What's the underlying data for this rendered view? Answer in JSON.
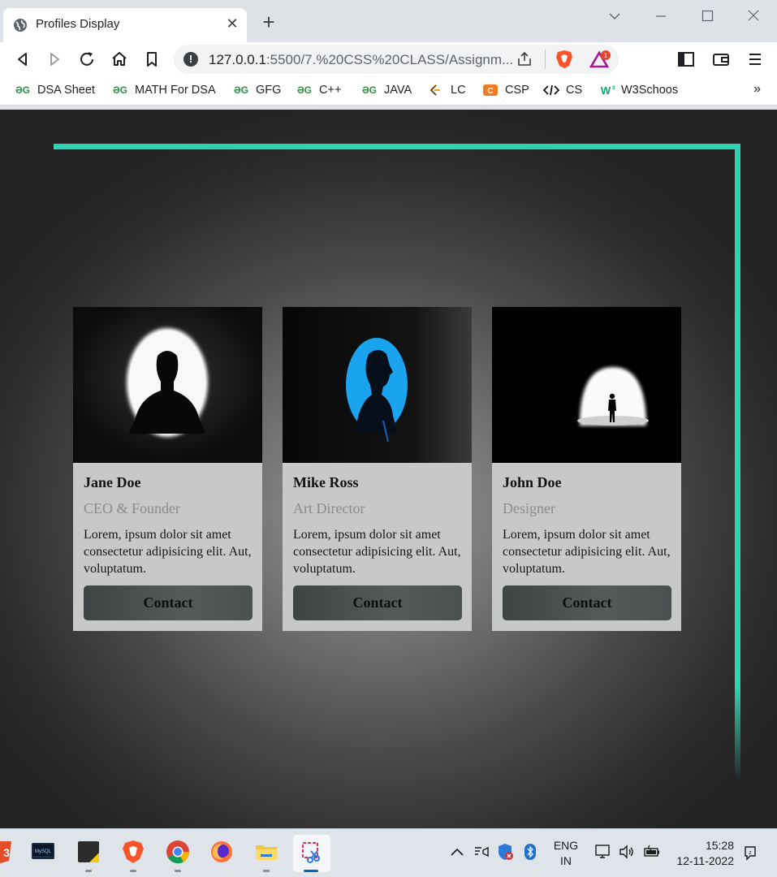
{
  "browser": {
    "tab_title": "Profiles Display",
    "tab_close": "✕",
    "new_tab": "+",
    "url_host": "127.0.0.1",
    "url_path": ":5500/7.%20CSS%20CLASS/Assignm...",
    "rewards_badge": "1",
    "more_bookmarks": "»"
  },
  "bookmarks": [
    {
      "label": "DSA Sheet",
      "icon": "geeksforgeeks-icon"
    },
    {
      "label": "MATH For DSA",
      "icon": "geeksforgeeks-icon"
    },
    {
      "label": "GFG",
      "icon": "geeksforgeeks-icon"
    },
    {
      "label": "C++",
      "icon": "geeksforgeeks-icon"
    },
    {
      "label": "JAVA",
      "icon": "geeksforgeeks-icon"
    },
    {
      "label": "LC",
      "icon": "leetcode-icon"
    },
    {
      "label": "CSP",
      "icon": "codestudio-icon"
    },
    {
      "label": "CS",
      "icon": "code-icon"
    },
    {
      "label": "W3Schoos",
      "icon": "w3schools-icon"
    }
  ],
  "profiles": [
    {
      "name": "Jane Doe",
      "role": "CEO & Founder",
      "description": "Lorem, ipsum dolor sit amet consectetur adipisicing elit. Aut, voluptatum.",
      "button": "Contact"
    },
    {
      "name": "Mike Ross",
      "role": "Art Director",
      "description": "Lorem, ipsum dolor sit amet consectetur adipisicing elit. Aut, voluptatum.",
      "button": "Contact"
    },
    {
      "name": "John Doe",
      "role": "Designer",
      "description": "Lorem, ipsum dolor sit amet consectetur adipisicing elit. Aut, voluptatum.",
      "button": "Contact"
    }
  ],
  "colors": {
    "neon_border": "#2ed3b4",
    "card_bg": "#c7c8c8",
    "button_bg": "#4a4f50",
    "role_text": "#8a8b8b"
  },
  "taskbar": {
    "language_top": "ENG",
    "language_bottom": "IN",
    "time": "15:28",
    "date": "12-11-2022"
  }
}
